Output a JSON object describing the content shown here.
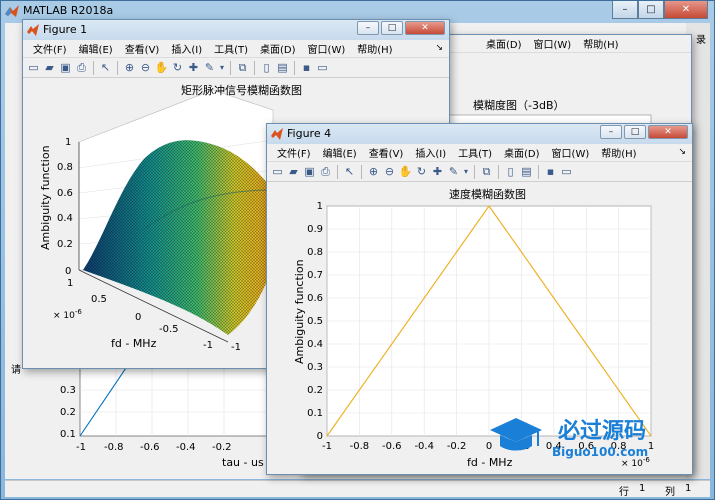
{
  "main": {
    "title": "MATLAB R2018a",
    "status_row_label": "行",
    "status_row_value": "1",
    "status_col_label": "列",
    "status_col_value": "1",
    "right_fragment": "录",
    "left_fragment": "请"
  },
  "menus": [
    "文件(F)",
    "编辑(E)",
    "查看(V)",
    "插入(I)",
    "工具(T)",
    "桌面(D)",
    "窗口(W)",
    "帮助(H)"
  ],
  "figure1": {
    "title": "Figure 1",
    "plot_title": "矩形脉冲信号模糊函数图",
    "zlabel": "Ambiguity function",
    "ylabel": "fd - MHz",
    "z_ticks": [
      "1",
      "0.8",
      "0.6",
      "0.4",
      "0.2",
      "0"
    ],
    "fd_ticks": [
      "1",
      "0.5",
      "0",
      "-0.5",
      "-1"
    ],
    "fd_exp": "× 10",
    "fd_exp_power": "-6",
    "tau_tick_left": "-1"
  },
  "figure_back": {
    "menus_visible": [
      "桌面(D)",
      "窗口(W)",
      "帮助(H)"
    ],
    "plot_title": "模糊度图（-3dB）",
    "ytick_labels": [
      "0.3",
      "0.2",
      "0.1"
    ],
    "xtick_labels": [
      "-1",
      "-0.8",
      "-0.6",
      "-0.4",
      "-0.2"
    ],
    "xlabel": "tau - us"
  },
  "figure4": {
    "title": "Figure 4",
    "plot_title": "速度模糊函数图",
    "ylabel": "Ambiguity function",
    "xlabel": "fd - MHz",
    "x_exp": "× 10",
    "x_exp_power": "-6"
  },
  "watermark": {
    "text": "必过源码",
    "url": "Biguo100.com"
  },
  "chart_data": [
    {
      "type": "line",
      "title": "速度模糊函数图",
      "xlabel": "fd - MHz",
      "ylabel": "Ambiguity function",
      "x_multiplier_label": "× 10^-6",
      "xlim": [
        -1,
        1
      ],
      "ylim": [
        0,
        1
      ],
      "x_ticks": [
        -1,
        -0.8,
        -0.6,
        -0.4,
        -0.2,
        0,
        0.2,
        0.4,
        0.6,
        0.8,
        1
      ],
      "y_ticks": [
        0,
        0.1,
        0.2,
        0.3,
        0.4,
        0.5,
        0.6,
        0.7,
        0.8,
        0.9,
        1
      ],
      "grid": true,
      "color": "#EDB120",
      "series": [
        {
          "x": [
            -1,
            -0.9,
            -0.8,
            -0.7,
            -0.6,
            -0.5,
            -0.4,
            -0.3,
            -0.2,
            -0.1,
            0,
            0.1,
            0.2,
            0.3,
            0.4,
            0.5,
            0.6,
            0.7,
            0.8,
            0.9,
            1
          ],
          "values": [
            0,
            0.1,
            0.2,
            0.3,
            0.4,
            0.5,
            0.6,
            0.7,
            0.8,
            0.9,
            1,
            0.9,
            0.8,
            0.7,
            0.6,
            0.5,
            0.4,
            0.3,
            0.2,
            0.1,
            0
          ]
        }
      ]
    }
  ]
}
